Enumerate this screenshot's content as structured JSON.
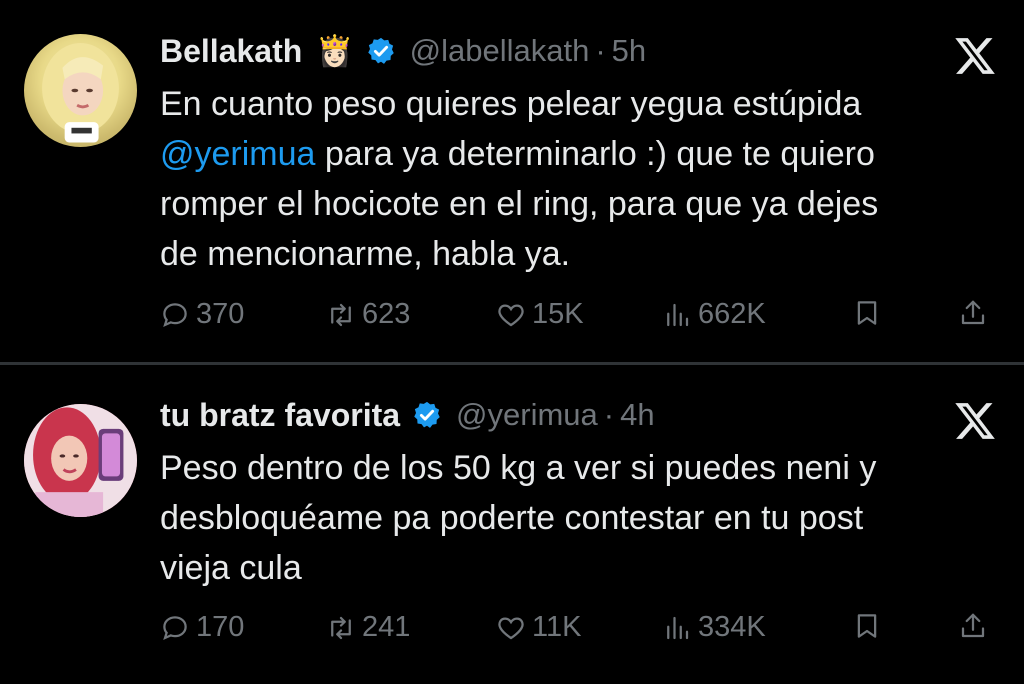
{
  "tweets": [
    {
      "name": "Bellakath",
      "emoji": "👸🏻",
      "handle": "@labellakath",
      "separator": "·",
      "time": "5h",
      "body_lines": [
        {
          "text": "En cuanto peso quieres pelear yegua estúpida",
          "mention": ""
        },
        {
          "text": " para ya determinarlo :) que te quiero",
          "mention": "@yerimua"
        },
        {
          "text": "romper el hocicote en el ring, para que ya dejes",
          "mention": ""
        },
        {
          "text": "de mencionarme, habla ya.",
          "mention": ""
        }
      ],
      "stats": {
        "replies": "370",
        "retweets": "623",
        "likes": "15K",
        "views": "662K"
      }
    },
    {
      "name": "tu bratz favorita",
      "emoji": "",
      "handle": "@yerimua",
      "separator": "·",
      "time": "4h",
      "body_lines": [
        {
          "text": "Peso dentro de los 50 kg a ver si puedes neni y",
          "mention": ""
        },
        {
          "text": "desbloquéame pa poderte contestar en tu post",
          "mention": ""
        },
        {
          "text": "vieja cula",
          "mention": ""
        }
      ],
      "stats": {
        "replies": "170",
        "retweets": "241",
        "likes": "11K",
        "views": "334K"
      }
    }
  ],
  "icons": {
    "verified": "verified-badge-icon",
    "x_logo": "x-logo-icon",
    "reply": "reply-icon",
    "retweet": "retweet-icon",
    "like": "heart-icon",
    "views": "views-icon",
    "bookmark": "bookmark-icon",
    "share": "share-icon"
  },
  "colors": {
    "background": "#000000",
    "text": "#e7e9ea",
    "muted": "#71767b",
    "accent": "#1d9bf0"
  }
}
